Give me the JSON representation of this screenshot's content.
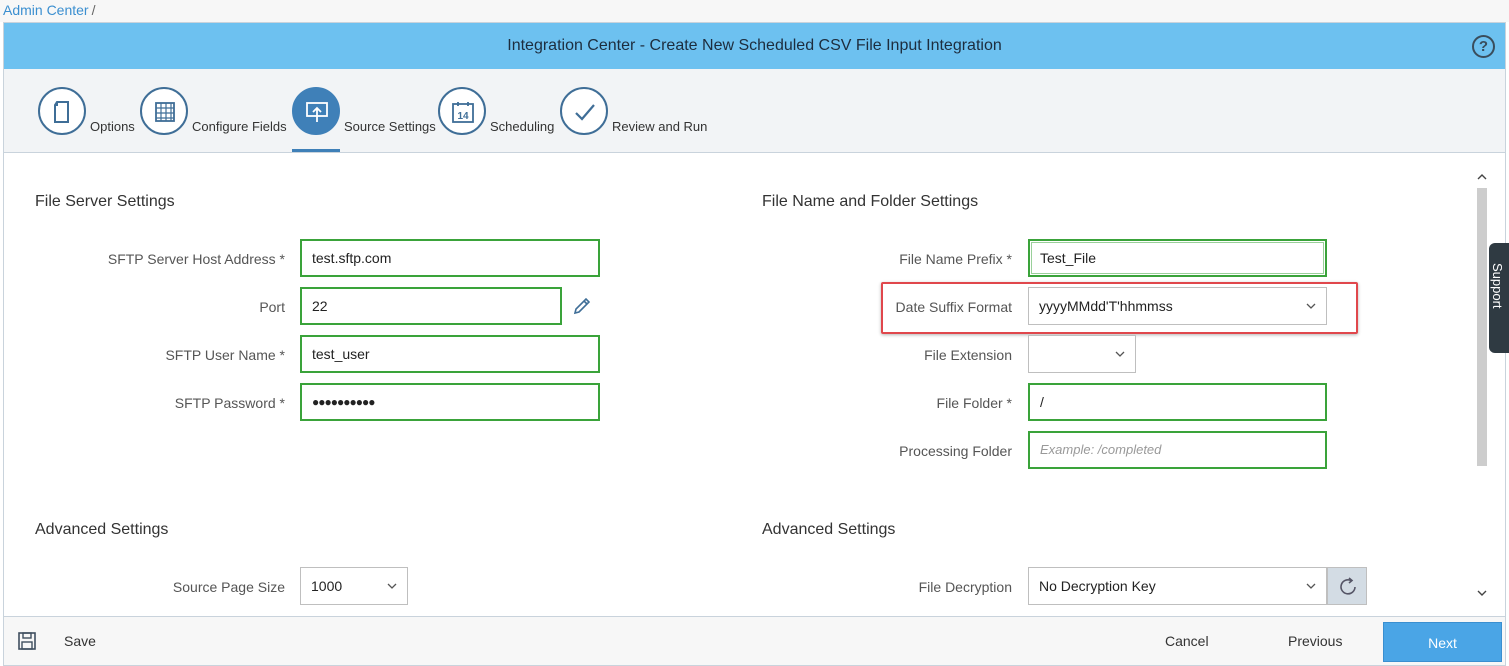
{
  "breadcrumb": {
    "link": "Admin Center",
    "sep": "/"
  },
  "title": "Integration Center - Create New Scheduled CSV File Input Integration",
  "help_icon": "?",
  "steps": [
    {
      "label": "Options",
      "icon": "document-icon"
    },
    {
      "label": "Configure Fields",
      "icon": "grid-icon"
    },
    {
      "label": "Source Settings",
      "icon": "upload-icon",
      "active": true
    },
    {
      "label": "Scheduling",
      "icon": "calendar-icon",
      "day": "14"
    },
    {
      "label": "Review and Run",
      "icon": "check-icon"
    }
  ],
  "file_server": {
    "title": "File Server Settings",
    "host_label": "SFTP Server Host Address *",
    "host_value": "test.sftp.com",
    "port_label": "Port",
    "port_value": "22",
    "user_label": "SFTP User Name *",
    "user_value": "test_user",
    "password_label": "SFTP Password *",
    "password_value": "●●●●●●●●●●"
  },
  "file_name": {
    "title": "File Name and Folder Settings",
    "prefix_label": "File Name Prefix *",
    "prefix_value": "Test_File",
    "date_suffix_label": "Date Suffix Format",
    "date_suffix_value": "yyyyMMdd'T'hhmmss",
    "extension_label": "File Extension",
    "extension_value": "",
    "folder_label": "File Folder *",
    "folder_value": "/",
    "processing_label": "Processing Folder",
    "processing_placeholder": "Example: /completed"
  },
  "advanced_left": {
    "title": "Advanced Settings",
    "page_size_label": "Source Page Size",
    "page_size_value": "1000"
  },
  "advanced_right": {
    "title": "Advanced Settings",
    "decryption_label": "File Decryption",
    "decryption_value": "No Decryption Key"
  },
  "support": "Support",
  "footer": {
    "save": "Save",
    "cancel": "Cancel",
    "previous": "Previous",
    "next": "Next"
  },
  "colors": {
    "titlebar": "#6dc1f0",
    "active_step": "#3f80b8",
    "valid_border": "#3aa33a",
    "highlight": "#e0474c",
    "next_button": "#4aa5e6"
  }
}
